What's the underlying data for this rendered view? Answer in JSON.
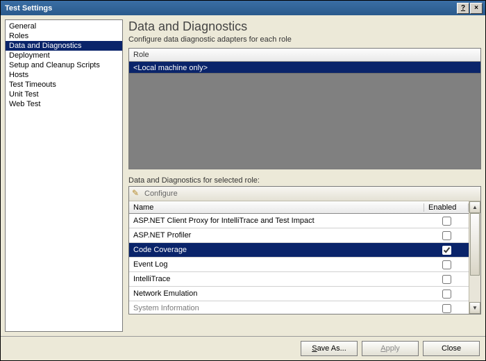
{
  "window": {
    "title": "Test Settings",
    "help": "?",
    "close": "×"
  },
  "sidebar": {
    "items": [
      {
        "label": "General"
      },
      {
        "label": "Roles"
      },
      {
        "label": "Data and Diagnostics",
        "selected": true
      },
      {
        "label": "Deployment"
      },
      {
        "label": "Setup and Cleanup Scripts"
      },
      {
        "label": "Hosts"
      },
      {
        "label": "Test Timeouts"
      },
      {
        "label": "Unit Test"
      },
      {
        "label": "Web Test"
      }
    ]
  },
  "page": {
    "title": "Data and Diagnostics",
    "subtitle": "Configure data diagnostic adapters for each role"
  },
  "role": {
    "header": "Role",
    "selected": "<Local machine only>"
  },
  "diagnostics": {
    "label": "Data and Diagnostics for selected role:",
    "configure": "Configure",
    "columns": {
      "name": "Name",
      "enabled": "Enabled"
    },
    "rows": [
      {
        "name": "ASP.NET Client Proxy for IntelliTrace and Test Impact",
        "enabled": false
      },
      {
        "name": "ASP.NET Profiler",
        "enabled": false
      },
      {
        "name": "Code Coverage",
        "enabled": true,
        "selected": true
      },
      {
        "name": "Event Log",
        "enabled": false
      },
      {
        "name": "IntelliTrace",
        "enabled": false
      },
      {
        "name": "Network Emulation",
        "enabled": false
      },
      {
        "name": "System Information",
        "enabled": false,
        "partial": true
      }
    ]
  },
  "footer": {
    "save_as": "Save As...",
    "save_as_accel": "S",
    "apply": "Apply",
    "apply_accel": "A",
    "close": "Close"
  }
}
